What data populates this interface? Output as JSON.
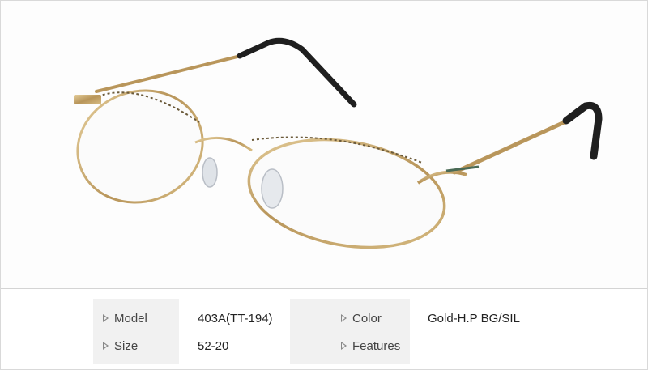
{
  "product_image": {
    "icon": "eyeglasses-icon",
    "frame_color": "#c9a96a",
    "tip_color": "#1f1f1f"
  },
  "specs": {
    "model_label": "Model",
    "model_value": "403A(TT-194)",
    "size_label": "Size",
    "size_value": "52-20",
    "color_label": "Color",
    "color_value": "Gold-H.P BG/SIL",
    "features_label": "Features",
    "features_value": ""
  }
}
